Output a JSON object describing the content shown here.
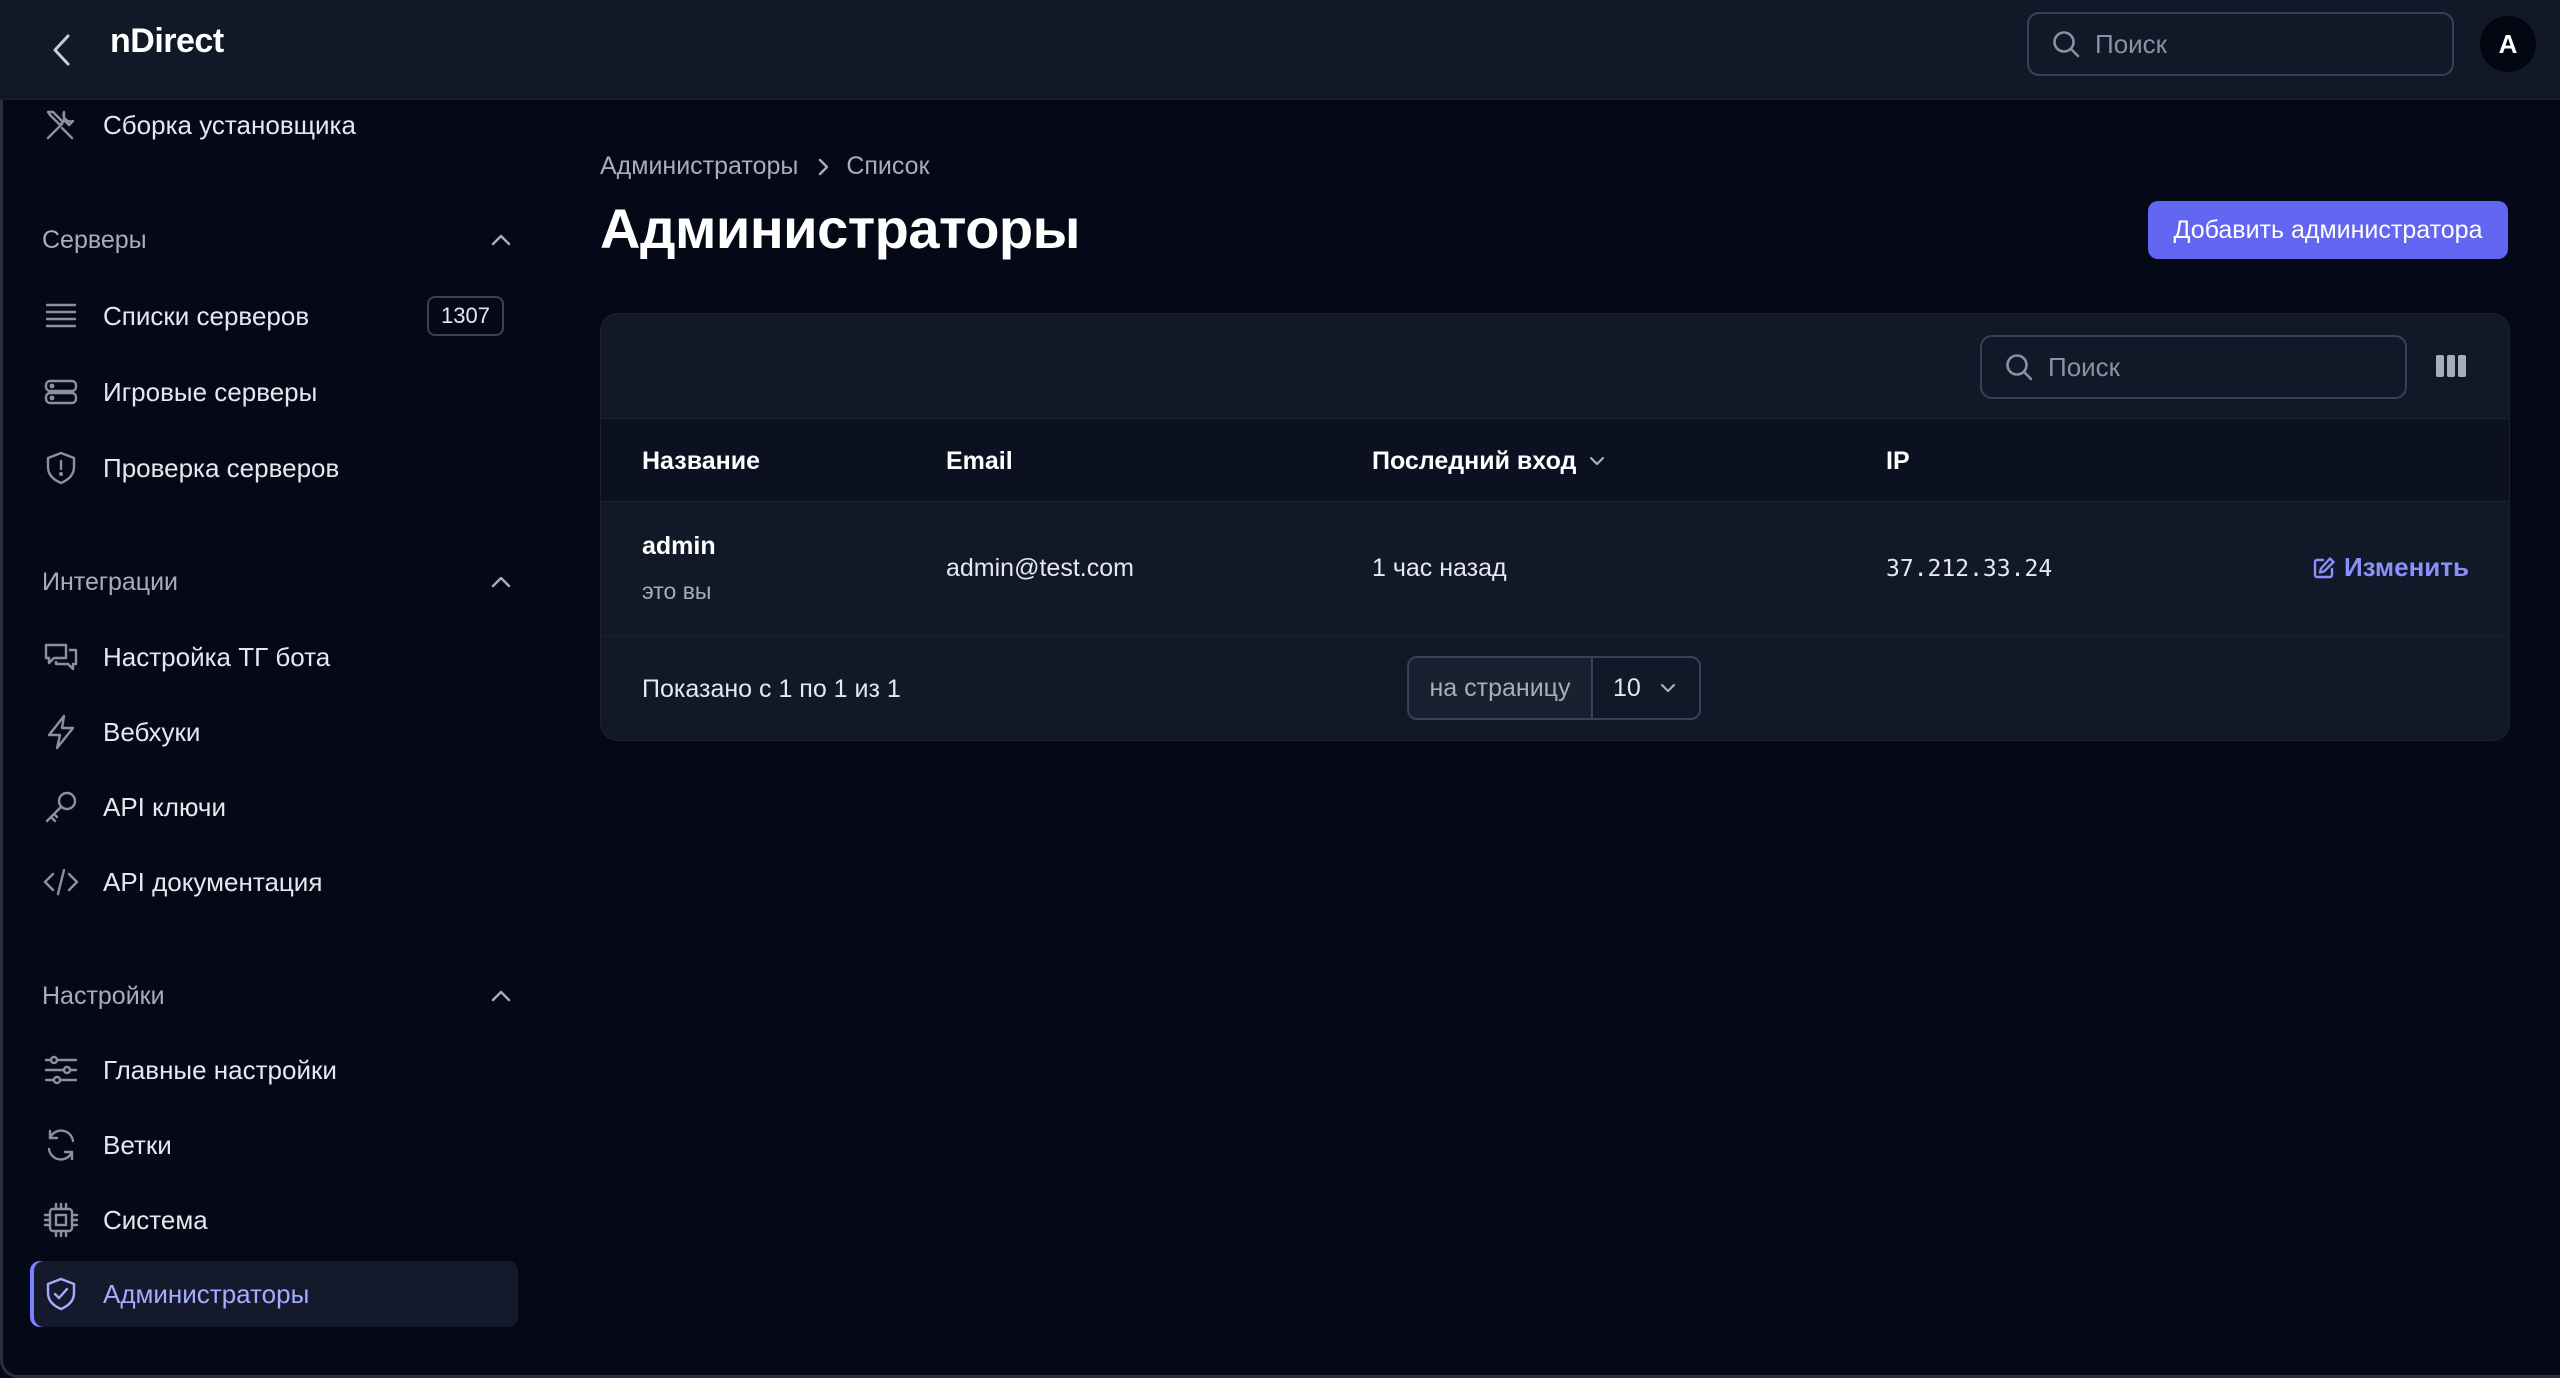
{
  "app": {
    "brand": "nDirect"
  },
  "header": {
    "search_placeholder": "Поиск",
    "avatar_initial": "A"
  },
  "sidebar": {
    "top_item": {
      "label": "Сборка установщика",
      "icon": "tools-icon"
    },
    "groups": [
      {
        "label": "Серверы",
        "items": [
          {
            "label": "Списки серверов",
            "icon": "server-list-icon",
            "badge": "1307"
          },
          {
            "label": "Игровые серверы",
            "icon": "server-stack-icon"
          },
          {
            "label": "Проверка серверов",
            "icon": "shield-alert-icon"
          }
        ]
      },
      {
        "label": "Интеграции",
        "items": [
          {
            "label": "Настройка ТГ бота",
            "icon": "chat-bubbles-icon"
          },
          {
            "label": "Вебхуки",
            "icon": "bolt-icon"
          },
          {
            "label": "API ключи",
            "icon": "key-icon"
          },
          {
            "label": "API документация",
            "icon": "code-icon"
          }
        ]
      },
      {
        "label": "Настройки",
        "items": [
          {
            "label": "Главные настройки",
            "icon": "sliders-icon"
          },
          {
            "label": "Ветки",
            "icon": "refresh-icon"
          },
          {
            "label": "Система",
            "icon": "cpu-chip-icon"
          },
          {
            "label": "Администраторы",
            "icon": "shield-check-icon",
            "active": true
          }
        ]
      }
    ]
  },
  "breadcrumb": {
    "parent": "Администраторы",
    "current": "Список"
  },
  "page": {
    "title": "Администраторы",
    "add_button": "Добавить администратора"
  },
  "table": {
    "search_placeholder": "Поиск",
    "columns": {
      "name": "Название",
      "email": "Email",
      "last_login": "Последний вход",
      "ip": "IP"
    },
    "rows": [
      {
        "name": "admin",
        "subtitle": "это вы",
        "email": "admin@test.com",
        "last_login": "1 час назад",
        "ip": "37.212.33.24",
        "action": "Изменить"
      }
    ],
    "footer": {
      "summary": "Показано с 1 по 1 из 1",
      "per_page_label": "на страницу",
      "per_page_value": "10"
    }
  },
  "colors": {
    "accent": "#6366f1",
    "accent_text": "#8b8ffb",
    "background": "#050816",
    "surface": "#111827"
  }
}
